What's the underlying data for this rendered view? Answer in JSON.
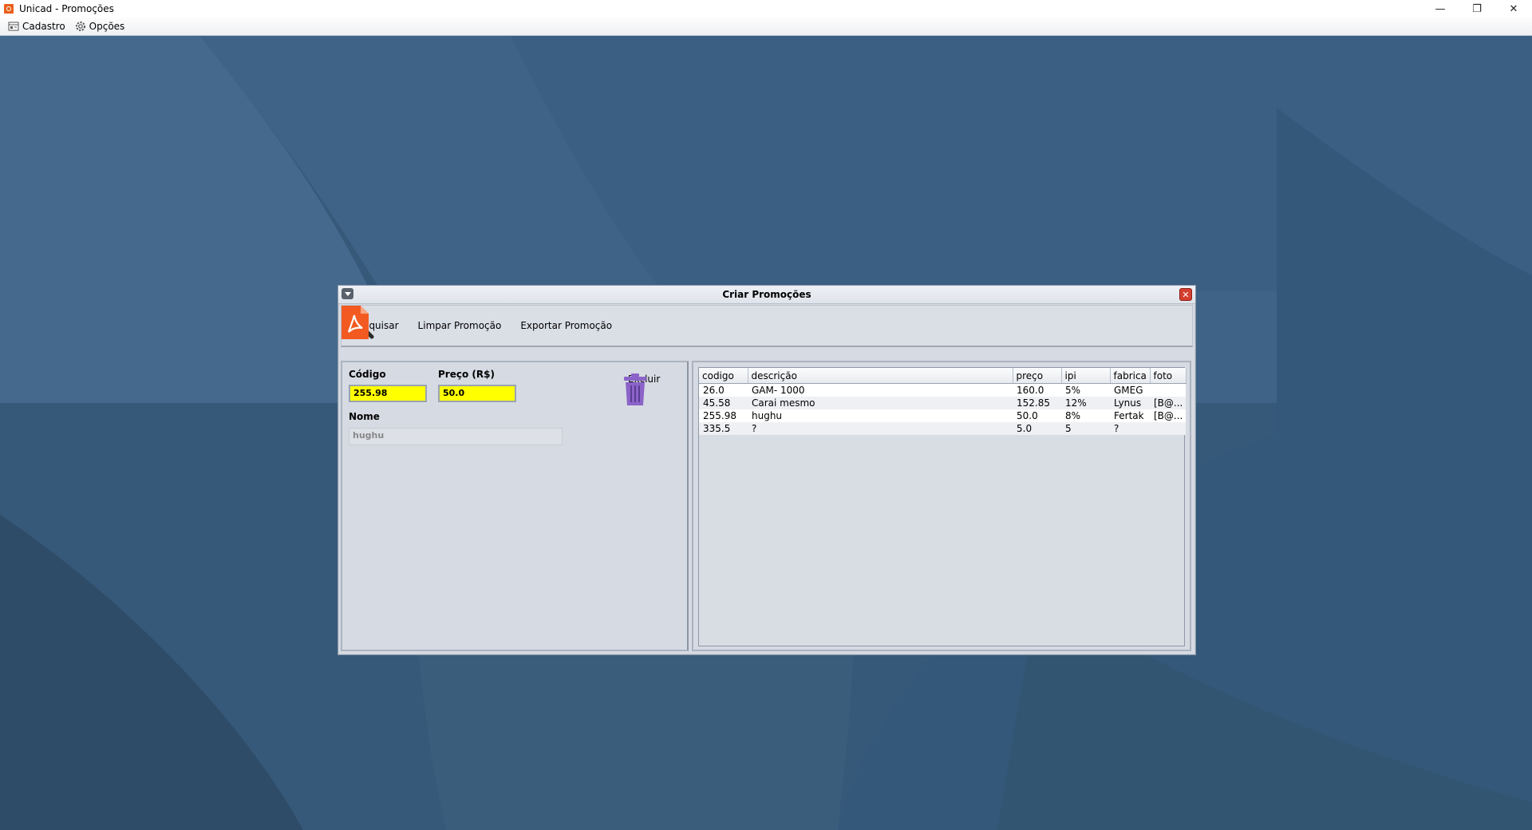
{
  "window": {
    "title": "Unicad - Promoções",
    "controls": {
      "minimize": "—",
      "restore": "❐",
      "close": "✕"
    }
  },
  "menubar": {
    "items": [
      {
        "label": "Cadastro",
        "icon": "register-icon"
      },
      {
        "label": "Opções",
        "icon": "gear-icon"
      }
    ]
  },
  "dialog": {
    "title": "Criar Promoções",
    "close_glyph": "✕",
    "toolbar": {
      "search_label": "Pesquisar",
      "clear_label": "Limpar Promoção",
      "export_label": "Exportar Promoção"
    },
    "form": {
      "codigo_label": "Código",
      "codigo_value": "255.98",
      "preco_label": "Preço (R$)",
      "preco_value": "50.0",
      "nome_label": "Nome",
      "nome_value": "hughu",
      "excluir_label": "Excluir"
    },
    "table": {
      "columns": [
        "codigo",
        "descrição",
        "preço",
        "ipi",
        "fabrica",
        "foto"
      ],
      "rows": [
        [
          "26.0",
          "GAM- 1000",
          "160.0",
          "5%",
          "GMEG",
          ""
        ],
        [
          "45.58",
          "Carai mesmo",
          "152.85",
          "12%",
          "Lynus",
          "[B@..."
        ],
        [
          "255.98",
          "hughu",
          "50.0",
          "8%",
          "Fertak",
          "[B@..."
        ],
        [
          "335.5",
          "?",
          "5.0",
          "5",
          "?",
          ""
        ]
      ]
    }
  },
  "colors": {
    "desktop": "#36597a",
    "field_highlight": "#ffff00",
    "close_button": "#d43f2f",
    "pdf_icon": "#f25a22",
    "trash_icon": "#8b63c9"
  }
}
